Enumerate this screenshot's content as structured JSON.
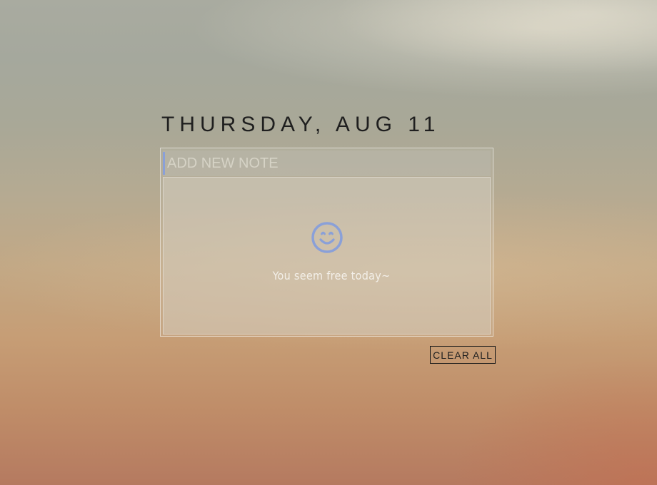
{
  "header": {
    "date_label": "THURSDAY, AUG 11"
  },
  "note_input": {
    "placeholder": "ADD NEW NOTE",
    "value": ""
  },
  "empty_state": {
    "icon": "smile-icon",
    "message": "You seem free today~"
  },
  "actions": {
    "clear_all_label": "CLEAR ALL"
  },
  "colors": {
    "accent": "#8aa0d8",
    "text_dark": "#1f1f1f"
  }
}
